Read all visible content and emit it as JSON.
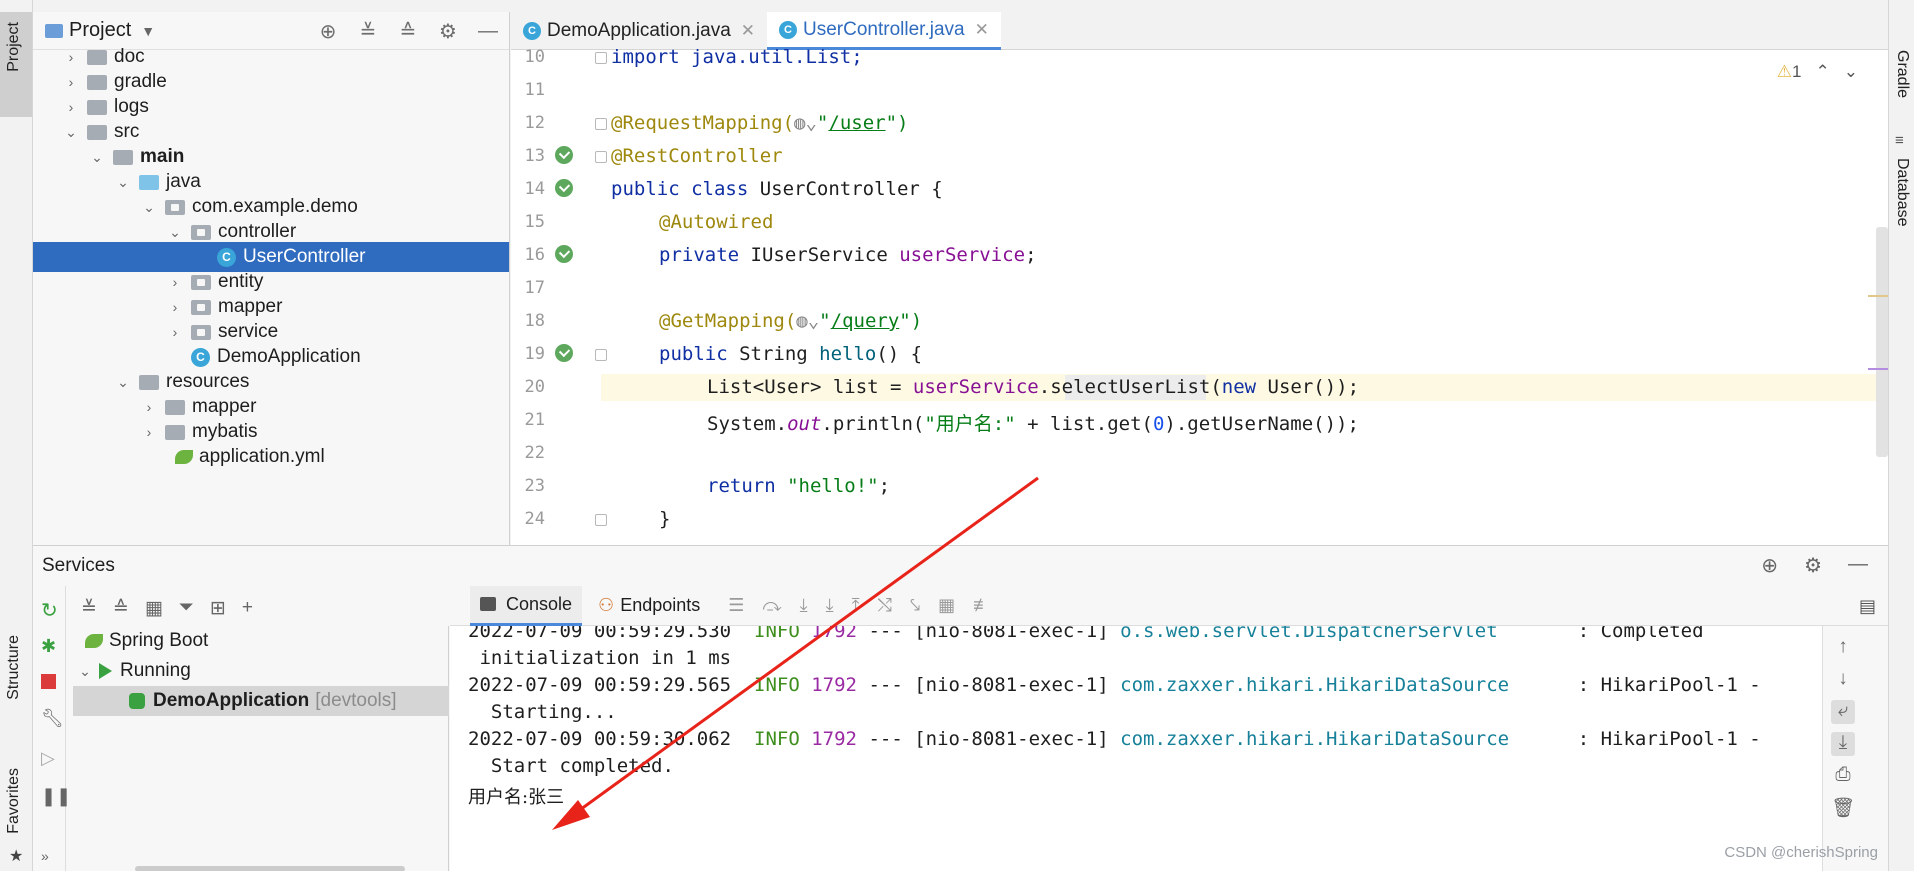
{
  "left_stripe": {
    "project": "Project",
    "structure": "Structure",
    "favorites": "Favorites"
  },
  "right_stripe": {
    "gradle": "Gradle",
    "database": "Database"
  },
  "project_panel": {
    "title": "Project",
    "tree": [
      {
        "label": "doc"
      },
      {
        "label": "gradle"
      },
      {
        "label": "logs"
      },
      {
        "label": "src"
      },
      {
        "label": "main"
      },
      {
        "label": "java"
      },
      {
        "label": "com.example.demo"
      },
      {
        "label": "controller"
      },
      {
        "label": "UserController"
      },
      {
        "label": "entity"
      },
      {
        "label": "mapper"
      },
      {
        "label": "service"
      },
      {
        "label": "DemoApplication"
      },
      {
        "label": "resources"
      },
      {
        "label": "mapper"
      },
      {
        "label": "mybatis"
      },
      {
        "label": "application.yml"
      }
    ]
  },
  "editor": {
    "tabs": [
      {
        "label": "DemoApplication.java"
      },
      {
        "label": "UserController.java"
      }
    ],
    "warning_count": "1",
    "lines": [
      {
        "n": "10",
        "text": "import java.util.List;"
      },
      {
        "n": "11",
        "text": ""
      },
      {
        "n": "12",
        "a": "@RequestMapping(",
        "b": "\"",
        "c": "/user",
        "d": "\")"
      },
      {
        "n": "13",
        "a": "@RestController"
      },
      {
        "n": "14",
        "a": "public class ",
        "b": "UserController {"
      },
      {
        "n": "15",
        "a": "@Autowired"
      },
      {
        "n": "16",
        "a": "private ",
        "b": "IUserService ",
        "c": "userService",
        "d": ";"
      },
      {
        "n": "17",
        "text": ""
      },
      {
        "n": "18",
        "a": "@GetMapping(",
        "b": "\"",
        "c": "/query",
        "d": "\")"
      },
      {
        "n": "19",
        "a": "public ",
        "b": "String ",
        "c": "hello",
        "d": "() {"
      },
      {
        "n": "20",
        "a": "List<User> list = ",
        "b": "userService",
        "c": ".selectUserList(",
        "d": "new ",
        "e": "User());"
      },
      {
        "n": "21",
        "a": "System.",
        "b": "out",
        "c": ".println(",
        "d": "\"用户名:\"",
        "e": " + list.get(",
        "f": "0",
        "g": ").getUserName());"
      },
      {
        "n": "22",
        "text": ""
      },
      {
        "n": "23",
        "a": "return ",
        "b": "\"hello!\"",
        "c": ";"
      },
      {
        "n": "24",
        "text": "}"
      }
    ]
  },
  "services": {
    "title": "Services",
    "tree": [
      {
        "label": "Spring Boot"
      },
      {
        "label": "Running"
      },
      {
        "label": "DemoApplication",
        "extra": "[devtools]"
      }
    ],
    "console_tabs": [
      {
        "label": "Console"
      },
      {
        "label": "Endpoints"
      }
    ],
    "console_lines": [
      {
        "date": "2022-07-09 00:59:29.530",
        "level": "INFO",
        "pid": "1792",
        "sep": "---",
        "thread": "[nio-8081-exec-1]",
        "logger": "o.s.web.servlet.DispatcherServlet",
        "msg": ": Completed"
      },
      {
        "cont": " initialization in 1 ms"
      },
      {
        "date": "2022-07-09 00:59:29.565",
        "level": "INFO",
        "pid": "1792",
        "sep": "---",
        "thread": "[nio-8081-exec-1]",
        "logger": "com.zaxxer.hikari.HikariDataSource",
        "msg": ": HikariPool-1 -"
      },
      {
        "cont": "  Starting..."
      },
      {
        "date": "2022-07-09 00:59:30.062",
        "level": "INFO",
        "pid": "1792",
        "sep": "---",
        "thread": "[nio-8081-exec-1]",
        "logger": "com.zaxxer.hikari.HikariDataSource",
        "msg": ": HikariPool-1 -"
      },
      {
        "cont": "  Start completed."
      },
      {
        "cont": "用户名:张三"
      }
    ]
  },
  "watermark": "CSDN @cherishSpring",
  "colors": {
    "accent": "#2f6bbf",
    "arrow": "#e8231a",
    "running": "#3aa140"
  }
}
